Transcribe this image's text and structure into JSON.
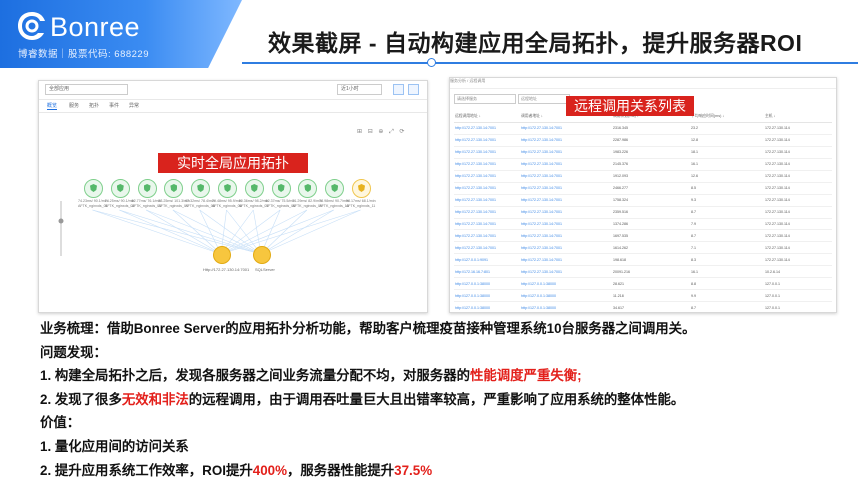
{
  "header": {
    "logo_text": "Bonree",
    "logo_sub": "博睿数据｜股票代码: 688229",
    "title": "效果截屏 - 自动构建应用全局拓扑，提升服务器ROI"
  },
  "left_panel": {
    "label": "实时全局应用拓扑",
    "select_value": "全部应用",
    "select2_value": "近1小时",
    "tabs": [
      "概览",
      "服务",
      "拓扑",
      "事件",
      "异常"
    ],
    "toolbar_icons": "⊞ ⊟ ⊕ ⤢ ⟳",
    "nodes": [
      {
        "cap1": "74.23ms/ 90.1/min",
        "cap2": "AFTK_nginxds_01"
      },
      {
        "cap1": "74.25ms/ 90.1/min",
        "cap2": "AFTK_nginxds_02"
      },
      {
        "cap1": "62.77ms/ 76.1/min",
        "cap2": "AFTK_nginxds_03"
      },
      {
        "cap1": "83.25ms/ 101.3/min",
        "cap2": "AFTK_nginxds_04"
      },
      {
        "cap1": "67.32ms/ 78.4/min",
        "cap2": "AFTK_nginxds_05"
      },
      {
        "cap1": "79.48ms/ 95.9/min",
        "cap2": "AFTK_nginxds_06"
      },
      {
        "cap1": "80.36ms/ 98.2/min",
        "cap2": "AFTK_nginxds_07"
      },
      {
        "cap1": "62.37ms/ 75.5/min",
        "cap2": "AFTK_nginxds_08"
      },
      {
        "cap1": "71.29ms/ 82.9/min",
        "cap2": "AFTK_nginxds_09"
      },
      {
        "cap1": "78.98ms/ 90.7/min",
        "cap2": "AFTK_nginxds_10"
      },
      {
        "cap1": "98.17ms/ 68.1/min",
        "cap2": "AFTK_nginxds_11"
      }
    ],
    "db_nodes": [
      "Http://172.27.130.14:7001",
      "SQLServer"
    ]
  },
  "right_panel": {
    "label": "远程调用关系列表",
    "breadcrumb": "服务分析 / 远程调用",
    "filter1": "请选择服务",
    "filter2": "远程地址",
    "columns": [
      "远程调用地址 ↓",
      "调用者地址 ↓",
      "调用次数(ms) ↓",
      "平均响应时间(ms) ↓",
      "主机 ↓"
    ],
    "rows": [
      [
        "http://172.27.130.14:7001",
        "http://172.27.130.14:7001",
        "2316.345",
        "23.2",
        "172.27.130.114"
      ],
      [
        "http://172.27.130.14:7001",
        "http://172.27.130.14:7001",
        "2287.986",
        "12.8",
        "172.27.130.114"
      ],
      [
        "http://172.27.130.14:7001",
        "http://172.27.130.14:7001",
        "1983.226",
        "18.1",
        "172.27.130.114"
      ],
      [
        "http://172.27.130.14:7001",
        "http://172.27.130.14:7001",
        "2145.376",
        "16.1",
        "172.27.130.114"
      ],
      [
        "http://172.27.130.14:7001",
        "http://172.27.130.14:7001",
        "1912.093",
        "12.6",
        "172.27.130.114"
      ],
      [
        "http://172.27.130.14:7001",
        "http://172.27.130.14:7001",
        "2466.277",
        "8.5",
        "172.27.130.114"
      ],
      [
        "http://172.27.130.14:7001",
        "http://172.27.130.14:7001",
        "1758.324",
        "9.3",
        "172.27.130.114"
      ],
      [
        "http://172.27.130.14:7001",
        "http://172.27.130.14:7001",
        "2359.516",
        "8.7",
        "172.27.130.114"
      ],
      [
        "http://172.27.130.14:7001",
        "http://172.27.130.14:7001",
        "1374.286",
        "7.9",
        "172.27.130.114"
      ],
      [
        "http://172.27.130.14:7001",
        "http://172.27.130.14:7001",
        "1697.535",
        "8.7",
        "172.27.130.114"
      ],
      [
        "http://172.27.130.14:7001",
        "http://172.27.130.14:7001",
        "1614.262",
        "7.1",
        "172.27.130.114"
      ],
      [
        "http://127.0.0.1:9091",
        "http://172.27.130.14:7001",
        "198.618",
        "8.3",
        "172.27.130.114"
      ],
      [
        "http://172.16.16.7:801",
        "http://172.27.130.14:7001",
        "20091.216",
        "16.1",
        "10.2.6.14"
      ],
      [
        "http://127.0.0.1:38000",
        "http://127.0.0.1:38000",
        "28.621",
        "8.8",
        "127.0.0.1"
      ],
      [
        "http://127.0.0.1:38000",
        "http://127.0.0.1:38000",
        "11.218",
        "9.9",
        "127.0.0.1"
      ],
      [
        "http://127.0.0.1:38000",
        "http://127.0.0.1:38000",
        "34.617",
        "8.7",
        "127.0.0.1"
      ],
      [
        "http://127.0.0.1:38000",
        "http://127.0.0.1:38000",
        "17.144",
        "8.2",
        "127.0.0.1"
      ]
    ]
  },
  "body": {
    "l1": "业务梳理：借助Bonree Server的应用拓扑分析功能，帮助客户梳理疫苗接种管理系统10台服务器之间调用关。",
    "l2": "问题发现：",
    "l3_a": "1. 构建全局拓扑之后，发现各服务器之间业务流量分配不均，对服务器的",
    "l3_b": "性能调度严重失衡;",
    "l4_a": "2. 发现了很多",
    "l4_b": "无效和非法",
    "l4_c": "的远程调用，由于调用吞吐量巨大且出错率较高，严重影响了应用系统的整体性能。",
    "l5": "价值：",
    "l6": "1. 量化应用间的访问关系",
    "l7_a": "2. 提升应用系统工作效率，ROI提升",
    "l7_b": "400%",
    "l7_c": "，服务器性能提升",
    "l7_d": "37.5%"
  },
  "colors": {
    "brand_blue": "#1d6fe0",
    "highlight_red": "#e3201b",
    "label_red": "#d9231d"
  }
}
